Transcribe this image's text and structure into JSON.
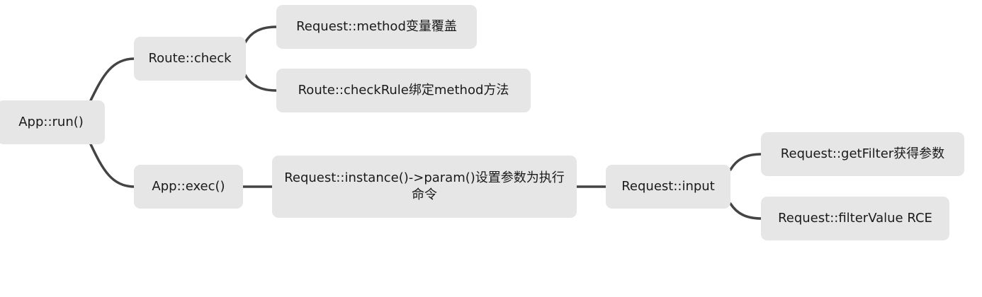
{
  "diagram": {
    "nodes": {
      "app_run": "App::run()",
      "route_check": "Route::check",
      "method_override": "Request::method变量覆盖",
      "check_rule": "Route::checkRule绑定method方法",
      "app_exec": "App::exec()",
      "instance_param": "Request::instance()->param()设置参数为执行命令",
      "request_input": "Request::input",
      "get_filter": "Request::getFilter获得参数",
      "filter_value": "Request::filterValue RCE"
    },
    "edges": [
      {
        "from": "app_run",
        "to": "route_check"
      },
      {
        "from": "app_run",
        "to": "app_exec"
      },
      {
        "from": "route_check",
        "to": "method_override"
      },
      {
        "from": "route_check",
        "to": "check_rule"
      },
      {
        "from": "app_exec",
        "to": "instance_param"
      },
      {
        "from": "instance_param",
        "to": "request_input"
      },
      {
        "from": "request_input",
        "to": "get_filter"
      },
      {
        "from": "request_input",
        "to": "filter_value"
      }
    ],
    "colors": {
      "node_fill": "#e6e6e6",
      "connector": "#444444",
      "text": "#1a1a1a"
    }
  }
}
